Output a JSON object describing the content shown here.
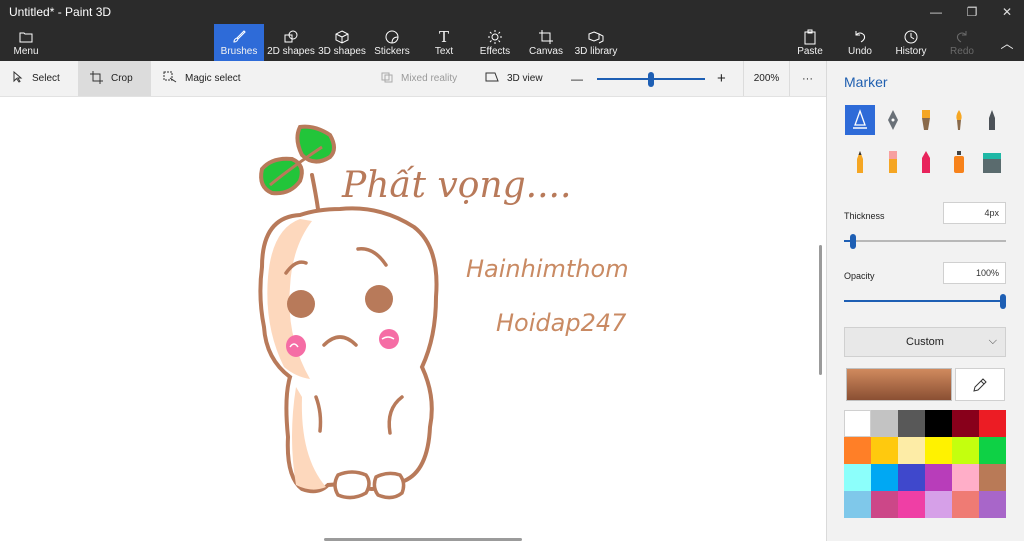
{
  "window": {
    "title": "Untitled* - Paint 3D",
    "minimize_glyph": "—",
    "maximize_glyph": "❐",
    "close_glyph": "✕"
  },
  "toolbar": {
    "menu_label": "Menu",
    "items": [
      {
        "label": "Brushes",
        "icon": "brush-icon",
        "active": true
      },
      {
        "label": "2D shapes",
        "icon": "2d-shapes-icon"
      },
      {
        "label": "3D shapes",
        "icon": "3d-shapes-icon"
      },
      {
        "label": "Stickers",
        "icon": "stickers-icon"
      },
      {
        "label": "Text",
        "icon": "text-icon"
      },
      {
        "label": "Effects",
        "icon": "effects-icon"
      },
      {
        "label": "Canvas",
        "icon": "canvas-icon"
      },
      {
        "label": "3D library",
        "icon": "3d-library-icon"
      }
    ],
    "right_items": [
      {
        "label": "Paste",
        "icon": "paste-icon"
      },
      {
        "label": "Undo",
        "icon": "undo-icon"
      },
      {
        "label": "History",
        "icon": "history-icon"
      },
      {
        "label": "Redo",
        "icon": "redo-icon",
        "disabled": true
      }
    ],
    "collapse_glyph": "︿"
  },
  "subbar": {
    "select_label": "Select",
    "crop_label": "Crop",
    "magic_select_label": "Magic select",
    "mixed_reality_label": "Mixed reality",
    "view3d_label": "3D view",
    "zoom_minus": "—",
    "zoom_plus": "+",
    "zoom_value": "200%",
    "zoom_level": 0.5,
    "more_glyph": "···"
  },
  "canvas": {
    "text1": "Phất vọng....",
    "text2": "Hainhimthom",
    "text3": "Hoidap247"
  },
  "panel": {
    "title": "Marker",
    "brushes": [
      {
        "name": "marker-icon",
        "selected": true
      },
      {
        "name": "calligraphy-pen-icon"
      },
      {
        "name": "oil-brush-icon"
      },
      {
        "name": "watercolor-icon"
      },
      {
        "name": "pixel-pen-icon"
      },
      {
        "name": "pencil-icon"
      },
      {
        "name": "eraser-icon"
      },
      {
        "name": "crayon-icon"
      },
      {
        "name": "spray-can-icon"
      },
      {
        "name": "fill-bucket-icon"
      }
    ],
    "thickness_label": "Thickness",
    "thickness_value": "4px",
    "thickness_level": 0.04,
    "opacity_label": "Opacity",
    "opacity_value": "100%",
    "opacity_level": 1.0,
    "color_mode": "Custom",
    "current_color_top": "#d08a5e",
    "current_color_bottom": "#8a4f33",
    "palette": [
      "#ffffff",
      "#c3c3c3",
      "#585858",
      "#000000",
      "#88001b",
      "#ec1c24",
      "#ff7f27",
      "#ffc90e",
      "#fdeca6",
      "#fff200",
      "#c4ff0e",
      "#0ed145",
      "#8cfffb",
      "#00a8f3",
      "#3f48cc",
      "#b83dba",
      "#ffaec8",
      "#b97a57",
      "#7fc8ea",
      "#cc4788",
      "#ef3fa5",
      "#d6a0e8",
      "#ef7b74",
      "#a866c9"
    ]
  },
  "colors": {
    "accent": "#2e6bd8",
    "titlebar": "#2b2b2b",
    "sketch_brown": "#b87a5a",
    "leaf_green": "#22c53a",
    "cheek_pink": "#f56da5",
    "body_fill": "#fdd8bd"
  }
}
